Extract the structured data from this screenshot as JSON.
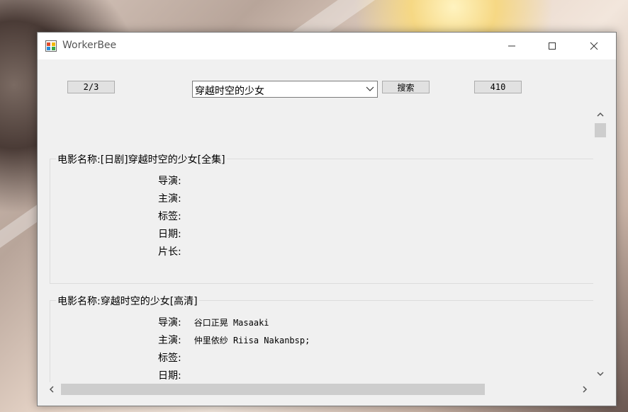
{
  "window": {
    "title": "WorkerBee",
    "accent_color": "#0078d7"
  },
  "toolbar": {
    "page_label": "2/3",
    "search_value": "穿越时空的少女",
    "search_button_label": "搜索",
    "count_label": "410"
  },
  "field_labels": {
    "director": "导演:",
    "cast": "主演:",
    "tags": "标签:",
    "date": "日期:",
    "length": "片长:"
  },
  "movies": [
    {
      "title": "电影名称:[日剧]穿越时空的少女[全集]",
      "director": "",
      "cast": "",
      "tags": "",
      "date": "",
      "length": ""
    },
    {
      "title": "电影名称:穿越时空的少女[高清]",
      "director": "谷口正晃 Masaaki",
      "cast": "仲里依纱 Riisa Nakanbsp;",
      "tags": "",
      "date": ""
    }
  ],
  "icons": {
    "app": "app-window-icon",
    "minimize": "minimize-icon",
    "maximize": "maximize-icon",
    "close": "close-icon"
  }
}
